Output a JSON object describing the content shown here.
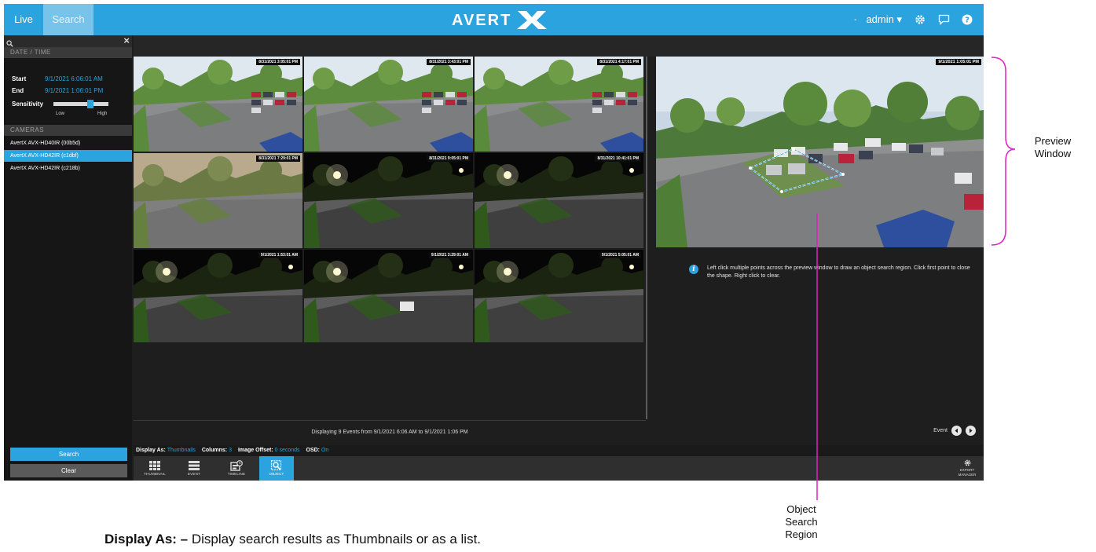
{
  "topbar": {
    "tabs": [
      {
        "label": "Live"
      },
      {
        "label": "Search"
      }
    ],
    "logo_text": "AVERTX",
    "separator": "-",
    "user": "admin",
    "icons": [
      "gear-icon",
      "chat-icon",
      "help-icon"
    ]
  },
  "sidebar": {
    "section_datetime": "DATE / TIME",
    "start_label": "Start",
    "start_value": "9/1/2021 6:06:01 AM",
    "end_label": "End",
    "end_value": "9/1/2021 1:06:01 PM",
    "sensitivity_label": "Sensitivity",
    "sensitivity_low": "Low",
    "sensitivity_high": "High",
    "sensitivity_level": 0.65,
    "section_cameras": "CAMERAS",
    "cameras": [
      {
        "label": "AvertX AVX-HD40IR (00b5d)",
        "selected": false
      },
      {
        "label": "AvertX AVX-HD42IR (c1dbf)",
        "selected": true
      },
      {
        "label": "AvertX AVX-HD42IR (c218b)",
        "selected": false
      }
    ],
    "search_button": "Search",
    "clear_button": "Clear"
  },
  "thumbnails": [
    {
      "timestamp": "8/31/2021 3:05:01 PM",
      "scene": "day"
    },
    {
      "timestamp": "8/31/2021 3:43:01 PM",
      "scene": "day"
    },
    {
      "timestamp": "8/31/2021 4:17:01 PM",
      "scene": "day"
    },
    {
      "timestamp": "8/31/2021 7:29:01 PM",
      "scene": "dusk"
    },
    {
      "timestamp": "8/31/2021 9:05:01 PM",
      "scene": "night"
    },
    {
      "timestamp": "8/31/2021 10:41:01 PM",
      "scene": "night"
    },
    {
      "timestamp": "9/1/2021 1:53:01 AM",
      "scene": "night"
    },
    {
      "timestamp": "9/1/2021 3:29:01 AM",
      "scene": "night"
    },
    {
      "timestamp": "9/1/2021 5:05:01 AM",
      "scene": "night"
    }
  ],
  "preview": {
    "timestamp": "9/1/2021 1:05:01 PM",
    "info_text": "Left click multiple points across the preview window to draw an object search region. Click first point to close the shape. Right click to clear."
  },
  "status_text": "Displaying 9 Events from 9/1/2021 6:06 AM to 9/1/2021 1:06 PM",
  "event_nav_label": "Event",
  "options": {
    "display_as_label": "Display As:",
    "display_as_value": "Thumbnails",
    "columns_label": "Columns:",
    "columns_value": "3",
    "image_offset_label": "Image Offset:",
    "image_offset_value": "0 seconds",
    "osd_label": "OSD:",
    "osd_value": "On"
  },
  "view_buttons": [
    {
      "label": "THUMBNAIL",
      "icon": "grid-icon",
      "selected": false
    },
    {
      "label": "EVENT",
      "icon": "list-icon",
      "selected": false
    },
    {
      "label": "TIMELINE",
      "icon": "timeline-icon",
      "selected": false
    },
    {
      "label": "OBJECT",
      "icon": "object-search-icon",
      "selected": true
    }
  ],
  "export_manager": {
    "line1": "EXPORT",
    "line2": "MANAGER"
  },
  "annotations": {
    "preview_window": [
      "Preview",
      "Window"
    ],
    "object_search_region": [
      "Object",
      "Search",
      "Region"
    ]
  },
  "caption": {
    "bold": "Display As: –",
    "text": " Display search results as Thumbnails or as a list."
  },
  "colors": {
    "accent": "#2aa3df",
    "annotation": "#e020c8"
  }
}
